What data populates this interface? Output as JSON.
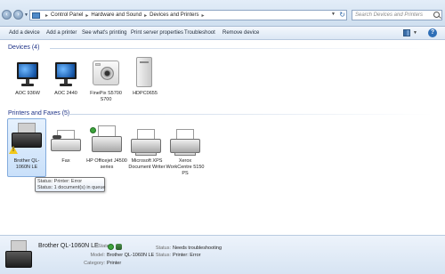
{
  "address": {
    "crumbs": [
      "Control Panel",
      "Hardware and Sound",
      "Devices and Printers"
    ],
    "search_placeholder": "Search Devices and Printers"
  },
  "toolbar": {
    "add_device": "Add a device",
    "add_printer": "Add a printer",
    "see_printing": "See what's printing",
    "server_props": "Print server properties",
    "troubleshoot": "Troubleshoot",
    "remove_device": "Remove device"
  },
  "devices": {
    "header": "Devices (4)",
    "items": [
      {
        "label": "AOC 936W",
        "icon": "monitor-icon"
      },
      {
        "label": "AOC 2440",
        "icon": "monitor-icon"
      },
      {
        "label": "FinePix S5700 S700",
        "icon": "camera-icon"
      },
      {
        "label": "HDPC0655",
        "icon": "computer-icon"
      }
    ]
  },
  "printers": {
    "header": "Printers and Faxes (5)",
    "items": [
      {
        "label": "Brother QL-1060N LE",
        "icon": "label-printer-icon",
        "status": "warning"
      },
      {
        "label": "Fax",
        "icon": "fax-icon"
      },
      {
        "label": "HP Officejet J4500 series",
        "icon": "printer-icon"
      },
      {
        "label": "Microsoft XPS Document Writer",
        "icon": "printer-icon"
      },
      {
        "label": "Xerox WorkCentre 5150 PS",
        "icon": "printer-icon"
      }
    ]
  },
  "tooltip": {
    "line1": "Status: Printer:  Error",
    "line2": "Status: 1 document(s) in queue"
  },
  "details": {
    "title": "Brother QL-1060N LE",
    "state_label": "State:",
    "model_label": "Model:",
    "model_value": "Brother QL-1060N LE",
    "category_label": "Category:",
    "category_value": "Printer",
    "status_label": "Status:",
    "status_value": "Needs troubleshooting",
    "status2_label": "Status:",
    "status2_value": "Printer:  Error"
  },
  "colors": {
    "group_header": "#1e3287",
    "selection": "#c9e0fa",
    "warning": "#f2c81a"
  }
}
